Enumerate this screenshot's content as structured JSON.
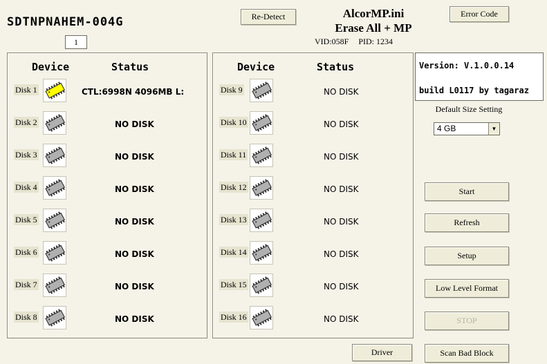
{
  "header": {
    "device_name": "SDTNPNAHEM-004G",
    "counter_value": "1",
    "redetect_label": "Re-Detect",
    "ini_title": "AlcorMP.ini",
    "ini_subtitle": "Erase All + MP",
    "vid": "VID:058F",
    "pid": "PID: 1234",
    "error_code_label": "Error Code"
  },
  "panels": {
    "device_header": "Device",
    "status_header": "Status"
  },
  "disks_left": [
    {
      "label": "Disk 1",
      "status": "CTL:6998N 4096MB L:",
      "active": true
    },
    {
      "label": "Disk 2",
      "status": "NO DISK",
      "active": false
    },
    {
      "label": "Disk 3",
      "status": "NO DISK",
      "active": false
    },
    {
      "label": "Disk 4",
      "status": "NO DISK",
      "active": false
    },
    {
      "label": "Disk 5",
      "status": "NO DISK",
      "active": false
    },
    {
      "label": "Disk 6",
      "status": "NO DISK",
      "active": false
    },
    {
      "label": "Disk 7",
      "status": "NO DISK",
      "active": false
    },
    {
      "label": "Disk 8",
      "status": "NO DISK",
      "active": false
    }
  ],
  "disks_right": [
    {
      "label": "Disk 9",
      "status": "NO DISK"
    },
    {
      "label": "Disk 10",
      "status": "NO DISK"
    },
    {
      "label": "Disk 11",
      "status": "NO DISK"
    },
    {
      "label": "Disk 12",
      "status": "NO DISK"
    },
    {
      "label": "Disk 13",
      "status": "NO DISK"
    },
    {
      "label": "Disk 14",
      "status": "NO DISK"
    },
    {
      "label": "Disk 15",
      "status": "NO DISK"
    },
    {
      "label": "Disk 16",
      "status": "NO DISK"
    }
  ],
  "sidebar": {
    "version_line1": "Version: V.1.0.0.14",
    "version_line2": "build L0117 by tagaraz",
    "size_setting_label": "Default Size Setting",
    "size_selected": "4 GB",
    "start_label": "Start",
    "refresh_label": "Refresh",
    "setup_label": "Setup",
    "low_level_format_label": "Low Level Format",
    "stop_label": "STOP",
    "scan_bad_block_label": "Scan Bad Block"
  },
  "footer": {
    "driver_label": "Driver"
  },
  "colors": {
    "background": "#f5f3e8",
    "active_chip": "#ffff00",
    "inactive_chip": "#b0b0b0"
  }
}
